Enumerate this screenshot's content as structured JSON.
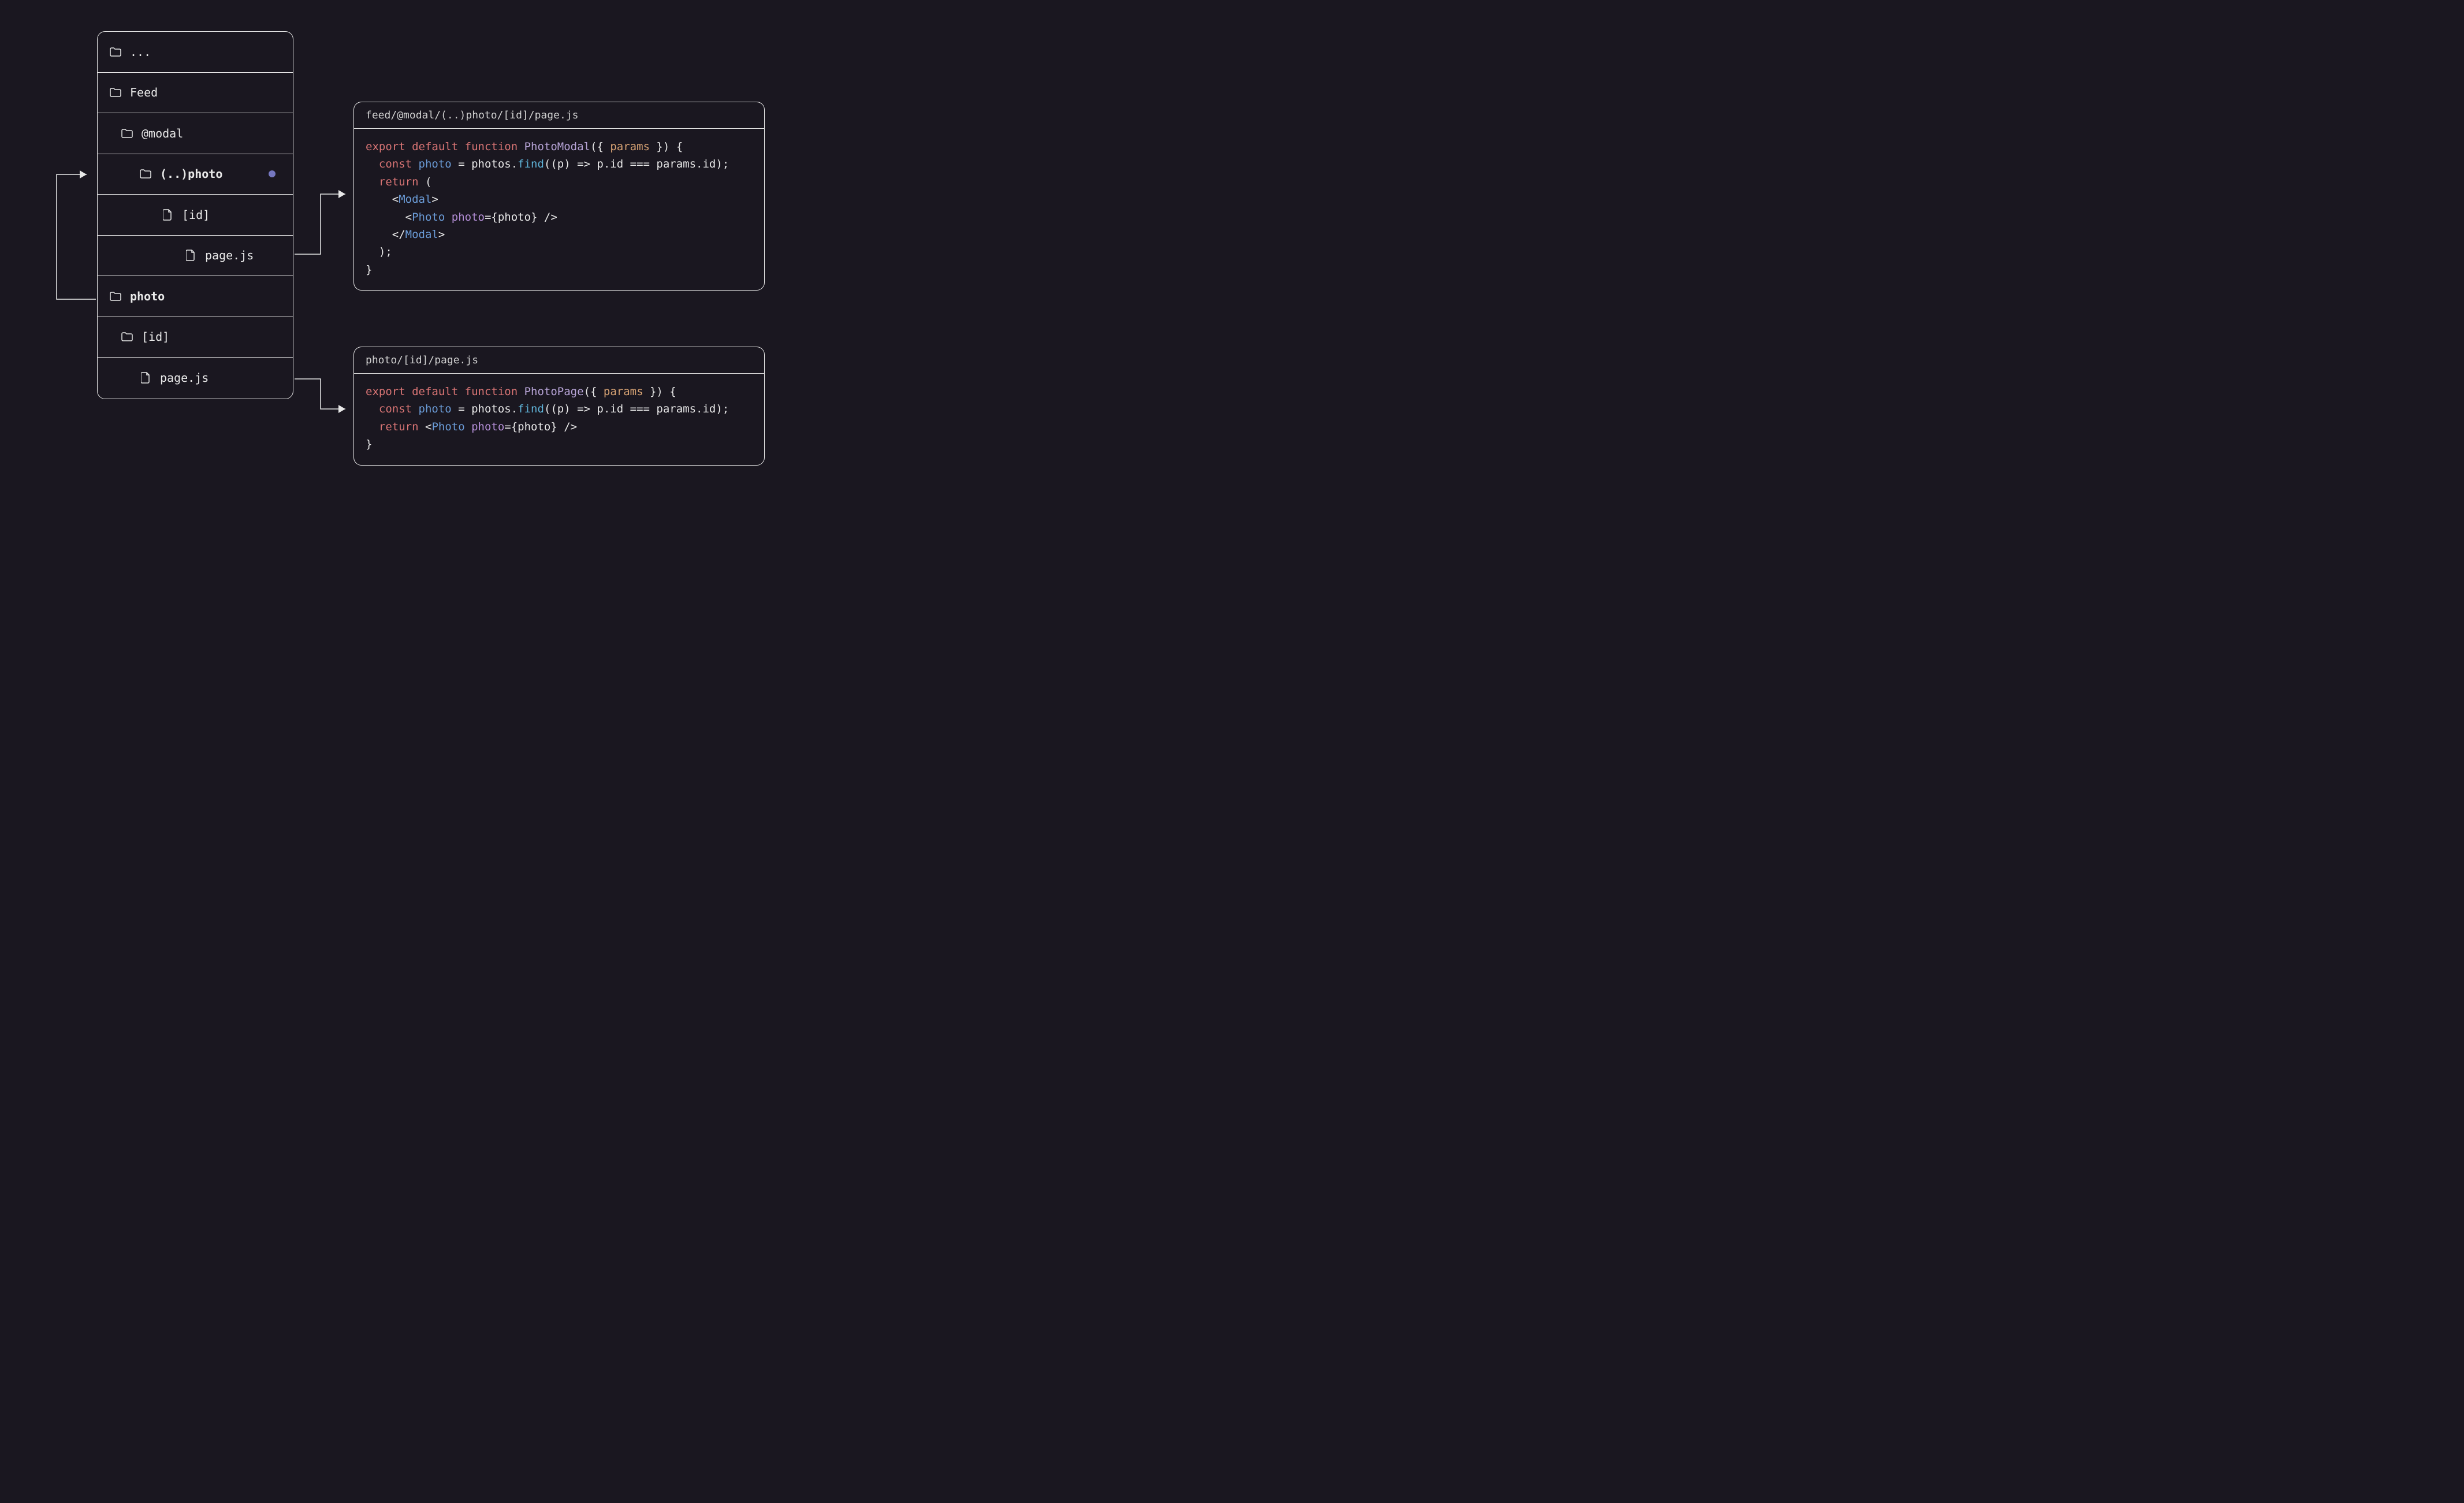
{
  "tree": {
    "rows": [
      {
        "kind": "folder",
        "label": "...",
        "indent": 0,
        "bold": false,
        "dot": false
      },
      {
        "kind": "folder",
        "label": "Feed",
        "indent": 0,
        "bold": false,
        "dot": false
      },
      {
        "kind": "folder",
        "label": "@modal",
        "indent": 1,
        "bold": false,
        "dot": false
      },
      {
        "kind": "folder",
        "label": "(..)photo",
        "indent": 2,
        "bold": true,
        "dot": true
      },
      {
        "kind": "file",
        "label": "[id]",
        "indent": 3,
        "bold": false,
        "dot": false
      },
      {
        "kind": "file",
        "label": "page.js",
        "indent": 4,
        "bold": false,
        "dot": false
      },
      {
        "kind": "folder",
        "label": "photo",
        "indent": 0,
        "bold": true,
        "dot": true
      },
      {
        "kind": "folder",
        "label": "[id]",
        "indent": 1,
        "bold": false,
        "dot": false
      },
      {
        "kind": "file",
        "label": "page.js",
        "indent": 2,
        "bold": false,
        "dot": false
      }
    ]
  },
  "panels": {
    "modal": {
      "title": "feed/@modal/(..)photo/[id]/page.js",
      "code_html": "<span class='kw-red'>export</span> <span class='kw-red'>default</span> <span class='kw-red'>function</span> <span class='fn'>PhotoModal</span><span class='plain'>({ </span><span class='kw-orange'>params</span><span class='plain'> }) {</span>\n  <span class='kw-red'>const</span> <span class='kw-blue'>photo</span> <span class='plain'>= photos.</span><span class='kw-cyan'>find</span><span class='plain'>((p) =&gt; p.id === params.id);</span>\n  <span class='kw-red'>return</span> <span class='plain'>(</span>\n    <span class='plain'>&lt;</span><span class='kw-blue'>Modal</span><span class='plain'>&gt;</span>\n      <span class='plain'>&lt;</span><span class='kw-blue'>Photo</span> <span class='kw-purple'>photo</span><span class='plain'>={photo} /&gt;</span>\n    <span class='plain'>&lt;/</span><span class='kw-blue'>Modal</span><span class='plain'>&gt;</span>\n  <span class='plain'>);</span>\n<span class='plain'>}</span>"
    },
    "page": {
      "title": "photo/[id]/page.js",
      "code_html": "<span class='kw-red'>export</span> <span class='kw-red'>default</span> <span class='kw-red'>function</span> <span class='fn'>PhotoPage</span><span class='plain'>({ </span><span class='kw-orange'>params</span><span class='plain'> }) {</span>\n  <span class='kw-red'>const</span> <span class='kw-blue'>photo</span> <span class='plain'>= photos.</span><span class='kw-cyan'>find</span><span class='plain'>((p) =&gt; p.id === params.id);</span>\n  <span class='kw-red'>return</span> <span class='plain'>&lt;</span><span class='kw-blue'>Photo</span> <span class='kw-purple'>photo</span><span class='plain'>={photo} /&gt;</span>\n<span class='plain'>}</span>"
    }
  }
}
